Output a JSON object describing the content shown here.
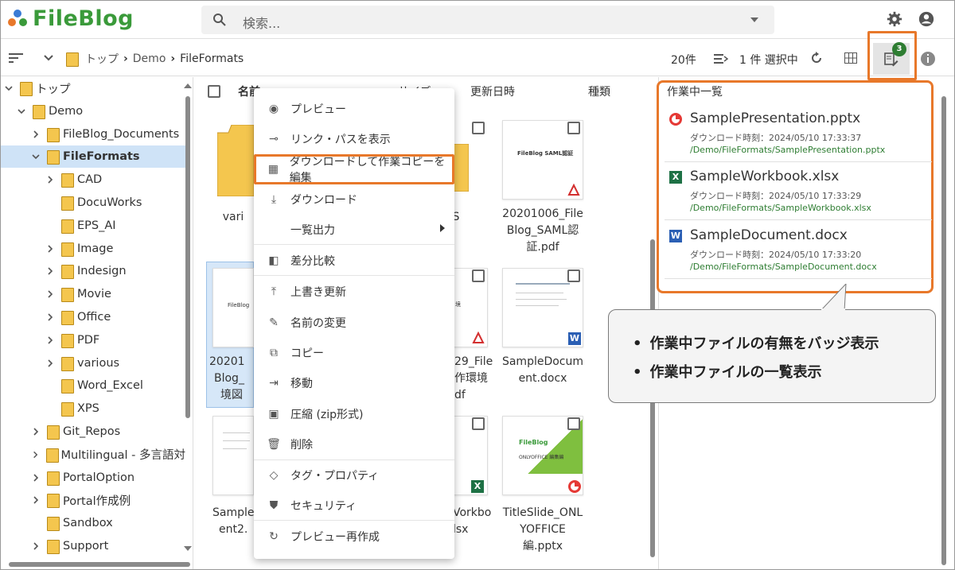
{
  "header": {
    "logo_text": "FileBlog",
    "search_placeholder": "検索..."
  },
  "toolbar": {
    "breadcrumb": [
      "トップ",
      "Demo",
      "FileFormats"
    ],
    "count": "20件",
    "selection": "1 件 選択中",
    "badge_count": "3"
  },
  "tree": [
    {
      "label": "トップ",
      "depth": 0,
      "expanded": true
    },
    {
      "label": "Demo",
      "depth": 1,
      "expanded": true
    },
    {
      "label": "FileBlog_Documents",
      "depth": 2
    },
    {
      "label": "FileFormats",
      "depth": 2,
      "expanded": true,
      "selected": true
    },
    {
      "label": "CAD",
      "depth": 3
    },
    {
      "label": "DocuWorks",
      "depth": 3,
      "leaf": true
    },
    {
      "label": "EPS_AI",
      "depth": 3,
      "leaf": true
    },
    {
      "label": "Image",
      "depth": 3
    },
    {
      "label": "Indesign",
      "depth": 3
    },
    {
      "label": "Movie",
      "depth": 3
    },
    {
      "label": "Office",
      "depth": 3
    },
    {
      "label": "PDF",
      "depth": 3
    },
    {
      "label": "various",
      "depth": 3
    },
    {
      "label": "Word_Excel",
      "depth": 3,
      "leaf": true
    },
    {
      "label": "XPS",
      "depth": 3,
      "leaf": true
    },
    {
      "label": "Git_Repos",
      "depth": 2
    },
    {
      "label": "Multilingual - 多言語対",
      "depth": 2
    },
    {
      "label": "PortalOption",
      "depth": 2
    },
    {
      "label": "Portal作成例",
      "depth": 2
    },
    {
      "label": "Sandbox",
      "depth": 2,
      "leaf": true
    },
    {
      "label": "Support",
      "depth": 2
    }
  ],
  "columns": {
    "name": "名前",
    "size": "サイズ",
    "modified": "更新日時",
    "type": "種類"
  },
  "files": {
    "f1": "vari",
    "f2": "S",
    "f3": [
      "20201006_File",
      "Blog_SAML認",
      "証.pdf"
    ],
    "f4": [
      "20201",
      "Blog_",
      "境図"
    ],
    "f5": [
      "29_File",
      "作環境",
      "df"
    ],
    "f6": [
      "SampleDocum",
      "ent.docx"
    ],
    "f7": [
      "Sample",
      "ent2."
    ],
    "f8": [
      "Vorkbo",
      "lsx"
    ],
    "f9": [
      "TitleSlide_ONL",
      "YOFFICE",
      "編.pptx"
    ]
  },
  "thumb_text": {
    "saml": "FileBlog SAML認証",
    "slide_brand": "FileBlog",
    "slide_sub": "ONLYOFFICE 編集編"
  },
  "menu": [
    {
      "label": "プレビュー",
      "icon": "eye-icon"
    },
    {
      "label": "リンク・パスを表示",
      "icon": "link-icon"
    },
    {
      "label": "ダウンロードして作業コピーを編集",
      "icon": "windows-icon",
      "highlight": true
    },
    {
      "label": "ダウンロード",
      "icon": "download-icon"
    },
    {
      "label": "一覧出力",
      "icon": "",
      "submenu": true
    },
    {
      "label": "差分比較",
      "icon": "compare-icon"
    },
    {
      "label": "上書き更新",
      "icon": "upload-icon"
    },
    {
      "label": "名前の変更",
      "icon": "pencil-icon"
    },
    {
      "label": "コピー",
      "icon": "copy-icon"
    },
    {
      "label": "移動",
      "icon": "move-icon"
    },
    {
      "label": "圧縮 (zip形式)",
      "icon": "archive-icon"
    },
    {
      "label": "削除",
      "icon": "trash-icon"
    },
    {
      "label": "タグ・プロパティ",
      "icon": "tag-icon"
    },
    {
      "label": "セキュリティ",
      "icon": "shield-icon"
    },
    {
      "label": "プレビュー再作成",
      "icon": "refresh-icon"
    }
  ],
  "work_panel": {
    "title": "作業中一覧",
    "items": [
      {
        "name": "SamplePresentation.pptx",
        "time": "ダウンロード時刻：2024/05/10 17:33:37",
        "path": "/Demo/FileFormats/SamplePresentation.pptx",
        "kind": "pptx"
      },
      {
        "name": "SampleWorkbook.xlsx",
        "time": "ダウンロード時刻：2024/05/10 17:33:29",
        "path": "/Demo/FileFormats/SampleWorkbook.xlsx",
        "kind": "xlsx"
      },
      {
        "name": "SampleDocument.docx",
        "time": "ダウンロード時刻：2024/05/10 17:33:20",
        "path": "/Demo/FileFormats/SampleDocument.docx",
        "kind": "docx"
      }
    ]
  },
  "callout": {
    "line1": "作業中ファイルの有無をバッジ表示",
    "line2": "作業中ファイルの一覧表示"
  },
  "colors": {
    "accent_orange": "#e8782a",
    "brand_green": "#3a9a3a",
    "path_green": "#2e7d32",
    "selected_row": "#cfe3f7"
  }
}
